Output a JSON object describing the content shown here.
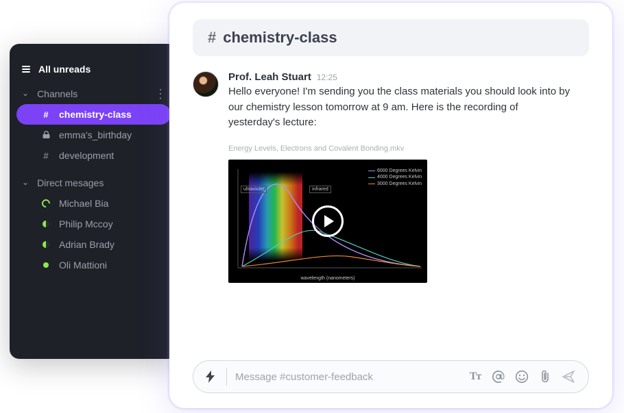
{
  "sidebar": {
    "all_unreads": "All unreads",
    "channels_label": "Channels",
    "channels": [
      {
        "name": "chemistry-class",
        "prefix": "#"
      },
      {
        "name": "emma's_birthday",
        "prefix": "lock"
      },
      {
        "name": "development",
        "prefix": "#"
      }
    ],
    "dm_label": "Direct mesages",
    "dms": [
      {
        "name": "Michael Bia",
        "status": "open-ring"
      },
      {
        "name": "Philip Mccoy",
        "status": "half"
      },
      {
        "name": "Adrian Brady",
        "status": "half"
      },
      {
        "name": "Oli Mattioni",
        "status": "online"
      }
    ]
  },
  "channel": {
    "hash": "#",
    "name": "chemistry-class"
  },
  "message": {
    "author": "Prof. Leah Stuart",
    "time": "12:25",
    "text": "Hello everyone! I'm sending you the class materials you should look into by our chemistry lesson tomorrow at 9 am. Here is the recording of yesterday's lecture:"
  },
  "attachment": {
    "filename": "Energy Levels, Electrons and Covalent Bonding.mkv",
    "labels": {
      "ultraviolet": "ultraviolet",
      "infrared": "infrared",
      "legend1": "6000 Degrees Kelvin",
      "legend2": "4000 Degrees Kelvin",
      "legend3": "3000 Degrees Kelvin",
      "xaxis": "wavelength (nanometers)"
    }
  },
  "composer": {
    "placeholder": "Message #customer-feedback",
    "tt_label": "Tт"
  }
}
